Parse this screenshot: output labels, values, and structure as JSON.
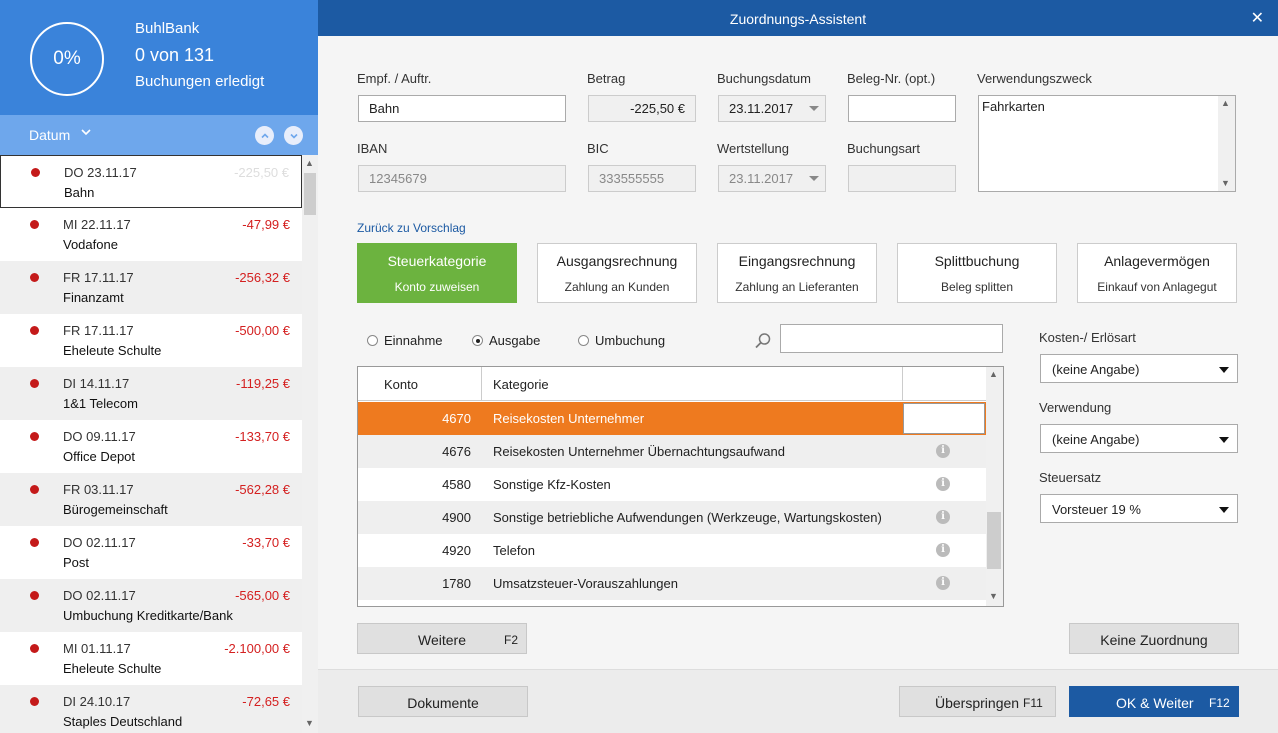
{
  "sidebar": {
    "progress_percent": "0%",
    "bank_name": "BuhlBank",
    "progress_count": "0 von 131",
    "progress_label": "Buchungen erledigt",
    "sort_label": "Datum",
    "bookings": [
      {
        "date": "DO 23.11.17",
        "name": "Bahn",
        "amount": "-225,50 €"
      },
      {
        "date": "MI 22.11.17",
        "name": "Vodafone",
        "amount": "-47,99 €"
      },
      {
        "date": "FR 17.11.17",
        "name": "Finanzamt",
        "amount": "-256,32 €"
      },
      {
        "date": "FR 17.11.17",
        "name": "Eheleute Schulte",
        "amount": "-500,00 €"
      },
      {
        "date": "DI 14.11.17",
        "name": "1&1 Telecom",
        "amount": "-119,25 €"
      },
      {
        "date": "DO 09.11.17",
        "name": "Office Depot",
        "amount": "-133,70 €"
      },
      {
        "date": "FR 03.11.17",
        "name": "Bürogemeinschaft",
        "amount": "-562,28 €"
      },
      {
        "date": "DO 02.11.17",
        "name": "Post",
        "amount": "-33,70 €"
      },
      {
        "date": "DO 02.11.17",
        "name": "Umbuchung Kreditkarte/Bank",
        "amount": "-565,00 €"
      },
      {
        "date": "MI 01.11.17",
        "name": "Eheleute Schulte",
        "amount": "-2.100,00 €"
      },
      {
        "date": "DI 24.10.17",
        "name": "Staples Deutschland",
        "amount": "-72,65 €"
      }
    ]
  },
  "window": {
    "title": "Zuordnungs-Assistent",
    "close": "✕"
  },
  "form": {
    "payee_label": "Empf. / Auftr.",
    "payee_value": "Bahn",
    "amount_label": "Betrag",
    "amount_value": "-225,50 €",
    "date_label": "Buchungsdatum",
    "date_value": "23.11.2017",
    "receipt_label": "Beleg-Nr. (opt.)",
    "receipt_value": "",
    "purpose_label": "Verwendungszweck",
    "purpose_value": "Fahrkarten",
    "iban_label": "IBAN",
    "iban_value": "12345679",
    "bic_label": "BIC",
    "bic_value": "333555555",
    "value_date_label": "Wertstellung",
    "value_date_value": "23.11.2017",
    "booking_type_label": "Buchungsart",
    "booking_type_value": ""
  },
  "back_link": "Zurück zu Vorschlag",
  "tabs": [
    {
      "title": "Steuerkategorie",
      "sub": "Konto zuweisen"
    },
    {
      "title": "Ausgangsrechnung",
      "sub": "Zahlung an Kunden"
    },
    {
      "title": "Eingangsrechnung",
      "sub": "Zahlung an Lieferanten"
    },
    {
      "title": "Splittbuchung",
      "sub": "Beleg splitten"
    },
    {
      "title": "Anlagevermögen",
      "sub": "Einkauf von Anlagegut"
    }
  ],
  "radios": {
    "income": "Einnahme",
    "expense": "Ausgabe",
    "transfer": "Umbuchung"
  },
  "grid": {
    "col_account": "Konto",
    "col_category": "Kategorie",
    "rows": [
      {
        "code": "4670",
        "category": "Reisekosten Unternehmer"
      },
      {
        "code": "4676",
        "category": "Reisekosten Unternehmer Übernachtungsaufwand"
      },
      {
        "code": "4580",
        "category": "Sonstige Kfz-Kosten"
      },
      {
        "code": "4900",
        "category": "Sonstige betriebliche Aufwendungen (Werkzeuge, Wartungskosten)"
      },
      {
        "code": "4920",
        "category": "Telefon"
      },
      {
        "code": "1780",
        "category": "Umsatzsteuer-Vorauszahlungen"
      }
    ]
  },
  "right_panel": {
    "cost_label": "Kosten-/ Erlösart",
    "cost_value": "(keine Angabe)",
    "usage_label": "Verwendung",
    "usage_value": "(keine Angabe)",
    "tax_label": "Steuersatz",
    "tax_value": "Vorsteuer 19 %"
  },
  "buttons": {
    "more": "Weitere",
    "more_key": "F2",
    "no_assignment": "Keine Zuordnung",
    "documents": "Dokumente",
    "skip": "Überspringen",
    "skip_key": "F11",
    "ok_next": "OK & Weiter",
    "ok_next_key": "F12"
  },
  "colors": {
    "header_blue": "#3a83da",
    "title_blue": "#1c5aa3",
    "active_green": "#6cb33f",
    "highlight_orange": "#ee7a1f",
    "negative_red": "#d42020"
  }
}
